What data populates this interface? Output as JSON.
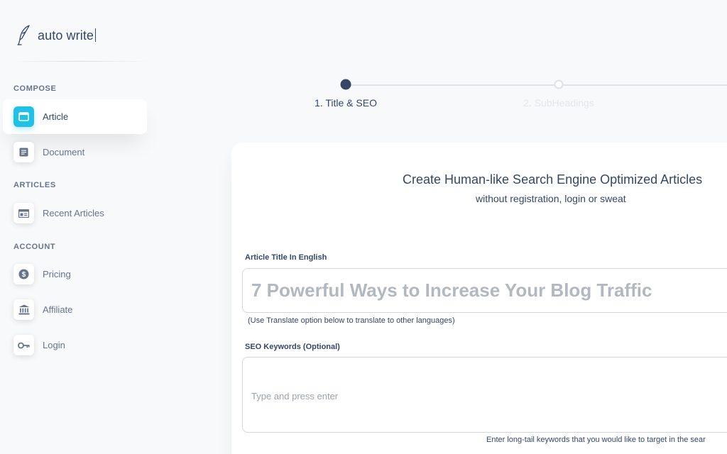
{
  "brand": {
    "name": "auto write",
    "icon": "quill-pen-icon"
  },
  "sidebar": {
    "sections": [
      {
        "label": "COMPOSE"
      },
      {
        "label": "ARTICLES"
      },
      {
        "label": "ACCOUNT"
      }
    ],
    "items": [
      {
        "label": "Article",
        "icon": "window-icon",
        "active": true
      },
      {
        "label": "Document",
        "icon": "document-icon",
        "active": false
      },
      {
        "label": "Recent Articles",
        "icon": "browser-list-icon",
        "active": false
      },
      {
        "label": "Pricing",
        "icon": "dollar-coin-icon",
        "active": false
      },
      {
        "label": "Affiliate",
        "icon": "bank-icon",
        "active": false
      },
      {
        "label": "Login",
        "icon": "key-icon",
        "active": false
      }
    ]
  },
  "stepper": {
    "steps": [
      {
        "label": "1. Title & SEO",
        "state": "current"
      },
      {
        "label": "2. SubHeadings",
        "state": "upcoming"
      }
    ]
  },
  "card": {
    "headline": "Create Human-like Search Engine Optimized Articles",
    "subline": "without registration, login or sweat",
    "title_field": {
      "label": "Article Title In English",
      "placeholder": "7 Powerful Ways to Increase Your Blog Traffic",
      "value": "",
      "hint": "(Use Translate option below to translate to other languages)"
    },
    "keywords_field": {
      "label": "SEO Keywords (Optional)",
      "placeholder": "Type and press enter",
      "hint": "Enter long-tail keywords that you would like to target in the sear"
    }
  },
  "colors": {
    "accent": "#21c1e6",
    "text_primary": "#344767",
    "text_secondary": "#67748e",
    "step_done": "#344767",
    "step_todo": "#dee2e6"
  }
}
